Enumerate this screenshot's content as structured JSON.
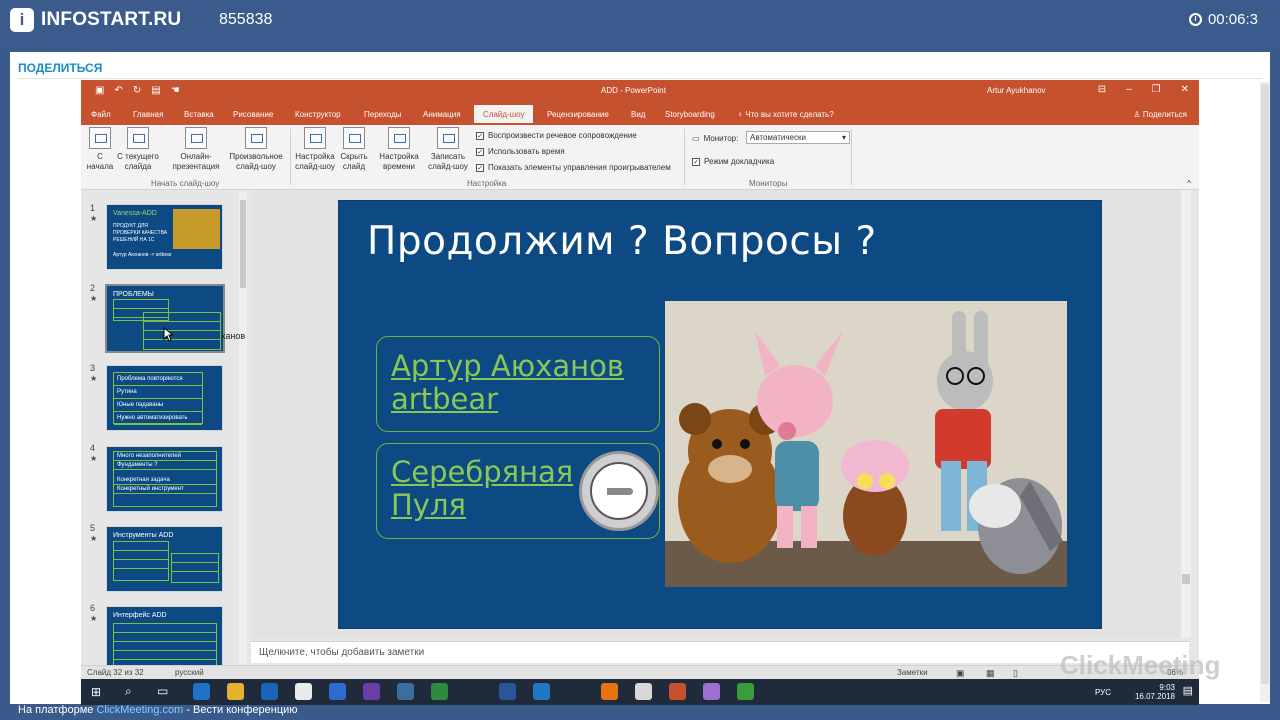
{
  "header": {
    "logo_text": "INFOSTART.RU",
    "conference_id": "855838",
    "timer": "00:06:3"
  },
  "share_label": "ПОДЕЛИТЬСЯ",
  "powerpoint": {
    "title": "ADD - PowerPoint",
    "user": "Artur Ayukhanov",
    "tabs": [
      "Файл",
      "Главная",
      "Вставка",
      "Рисование",
      "Конструктор",
      "Переходы",
      "Анимация",
      "Слайд-шоу",
      "Рецензирование",
      "Вид",
      "Storyboarding"
    ],
    "active_tab": "Слайд-шоу",
    "tell_me": "Что вы хотите сделать?",
    "share": "Поделиться",
    "ribbon": {
      "from_start": [
        "С",
        "начала"
      ],
      "from_current": [
        "С текущего",
        "слайда"
      ],
      "online": [
        "Онлайн-",
        "презентация"
      ],
      "custom": [
        "Произвольное",
        "слайд-шоу"
      ],
      "group_start": "Начать слайд-шоу",
      "setup": [
        "Настройка",
        "слайд-шоу"
      ],
      "hide": [
        "Скрыть",
        "слайд"
      ],
      "rehearse": [
        "Настройка",
        "времени"
      ],
      "record": [
        "Записать",
        "слайд-шоу"
      ],
      "chk_narration": "Воспроизвести речевое сопровождение",
      "chk_timings": "Использовать время",
      "chk_controls": "Показать элементы управления проигрывателем",
      "group_setup": "Настройка",
      "monitor_label": "Монитор:",
      "monitor_value": "Автоматически",
      "presenter_view": "Режим докладчика",
      "group_monitors": "Мониторы"
    },
    "thumbnails": [
      {
        "num": "1",
        "title": "Vanessa-ADD",
        "lines": [
          "ПРОДУКТ ДЛЯ",
          "ПРОВЕРКИ КАЧЕСТВА",
          "РЕШЕНИЙ НА 1С",
          "Артур Аюханов -> artbear"
        ]
      },
      {
        "num": "2",
        "title": "ПРОБЛЕМЫ",
        "lines": [
          "",
          "",
          "",
          ""
        ]
      },
      {
        "num": "3",
        "title": "",
        "lines": [
          "Проблема повторяются",
          "Рутина",
          "Юные падаваны",
          "Нужно автоматизировать"
        ]
      },
      {
        "num": "4",
        "title": "",
        "lines": [
          "Много незаполнителей",
          "Фундаменты ?",
          "Конкретная задача",
          "Конкретный инструмент"
        ]
      },
      {
        "num": "5",
        "title": "Инструменты ADD",
        "lines": [
          "",
          "",
          "",
          ""
        ]
      },
      {
        "num": "6",
        "title": "Интерфейс ADD",
        "lines": [
          "",
          "",
          "",
          ""
        ]
      }
    ],
    "thumb_overflow_text": "ханов",
    "slide": {
      "title": "Продолжим ? Вопросы ?",
      "box1": [
        "Артур Аюханов",
        "artbear"
      ],
      "box2": [
        "Серебряная",
        "Пуля"
      ]
    },
    "notes_placeholder": "Щелкните, чтобы добавить заметки",
    "status": {
      "slide_counter": "Слайд 32 из 32",
      "language": "русский",
      "notes": "Заметки",
      "zoom": "86%"
    },
    "tray": {
      "lang": "РУС",
      "time": "9:03",
      "date": "16.07.2018"
    }
  },
  "watermark": "ClickMeeting",
  "footer": {
    "prefix": "На платформе",
    "link": "ClickMeeting.com",
    "suffix": "- Вести конференцию"
  }
}
